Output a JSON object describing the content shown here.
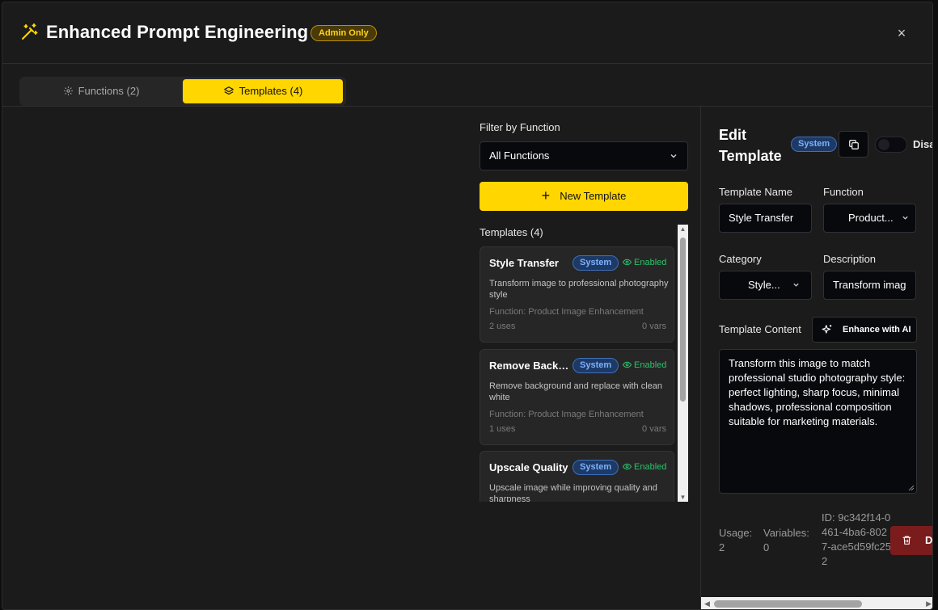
{
  "header": {
    "title": "Enhanced Prompt Engineering",
    "admin_badge": "Admin Only",
    "close_glyph": "×"
  },
  "tabs": [
    {
      "label": "Functions (2)",
      "icon": "gear-icon",
      "active": false
    },
    {
      "label": "Templates (4)",
      "icon": "layers-icon",
      "active": true
    }
  ],
  "filter": {
    "label": "Filter by Function",
    "selected": "All Functions"
  },
  "new_template_label": "New Template",
  "templates_heading": "Templates (4)",
  "templates": [
    {
      "name": "Style Transfer",
      "badge": "System",
      "status": "Enabled",
      "description": "Transform image to professional photography style",
      "function": "Function: Product Image Enhancement",
      "uses": "2 uses",
      "vars": "0 vars"
    },
    {
      "name": "Remove Background",
      "badge": "System",
      "status": "Enabled",
      "description": "Remove background and replace with clean white",
      "function": "Function: Product Image Enhancement",
      "uses": "1 uses",
      "vars": "0 vars"
    },
    {
      "name": "Upscale Quality",
      "badge": "System",
      "status": "Enabled",
      "description": "Upscale image while improving quality and sharpness",
      "function": "",
      "uses": "",
      "vars": ""
    }
  ],
  "edit": {
    "title": "Edit Template",
    "badge": "System",
    "toggle_label": "Disabled",
    "name_label": "Template Name",
    "name_value": "Style Transfer",
    "function_label": "Function",
    "function_value": "Product...",
    "category_label": "Category",
    "category_value": "Style...",
    "description_label": "Description",
    "description_value": "Transform imag",
    "content_label": "Template Content",
    "enhance_label": "Enhance with AI",
    "content_value": "Transform this image to match professional studio photography style: perfect lighting, sharp focus, minimal shadows, professional composition suitable for marketing materials.",
    "usage_label": "Usage:",
    "usage_value": "2",
    "variables_label": "Variables:",
    "variables_value": "0",
    "id_text": "ID: 9c342f14-0461-4ba6-8027-ace5d59fc252",
    "delete_label": "Delete"
  },
  "colors": {
    "accent": "#ffd600",
    "enabled": "#29c46a",
    "system_badge": "#7db1ff",
    "delete": "#7a1c1c"
  }
}
